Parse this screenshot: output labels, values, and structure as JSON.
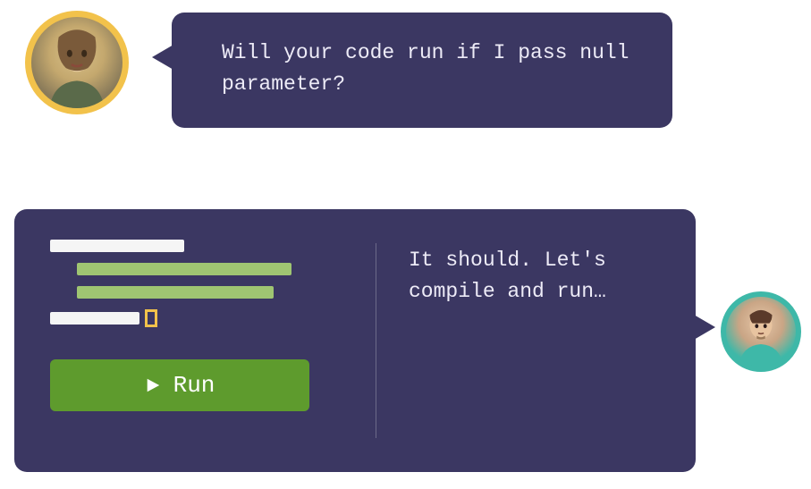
{
  "question": {
    "text": "Will your code run if I pass null parameter?"
  },
  "reply": {
    "text": "It should. Let's compile and run…"
  },
  "run_button": {
    "label": "Run"
  },
  "avatars": {
    "interviewer": {
      "ring_color": "#F2C24B",
      "icon": "person-icon"
    },
    "candidate": {
      "ring_color": "#3EB8A8",
      "icon": "person-icon"
    }
  },
  "code_editor": {
    "cursor_color": "#F2C24B"
  }
}
